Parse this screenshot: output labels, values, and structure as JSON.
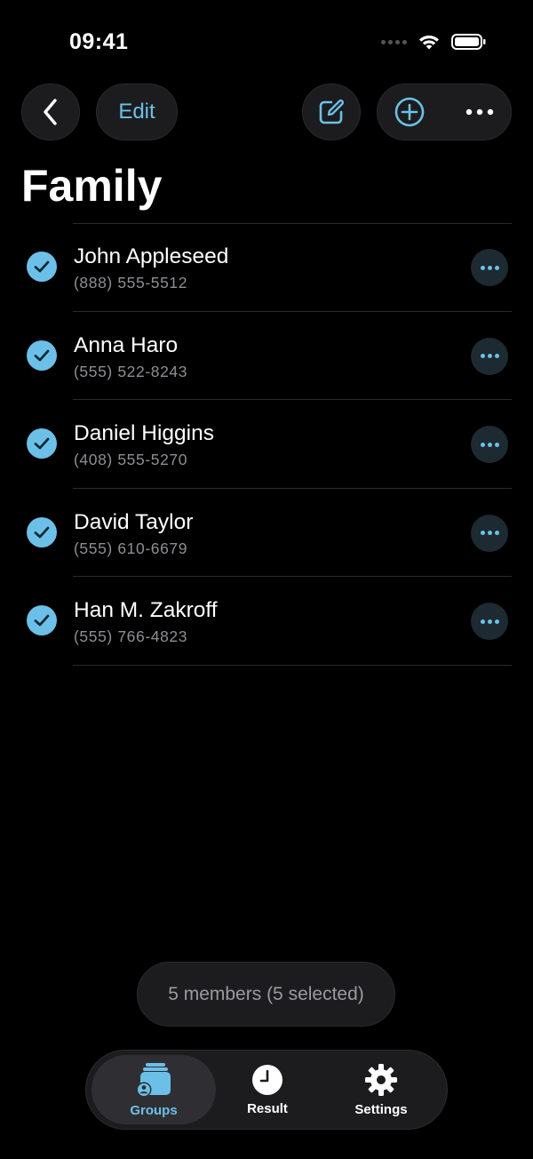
{
  "status_bar": {
    "time": "09:41"
  },
  "nav": {
    "edit_label": "Edit"
  },
  "page_title": "Family",
  "contacts": [
    {
      "name": "John Appleseed",
      "phone": "(888) 555-5512",
      "selected": true
    },
    {
      "name": "Anna Haro",
      "phone": "(555) 522-8243",
      "selected": true
    },
    {
      "name": "Daniel Higgins",
      "phone": "(408) 555-5270",
      "selected": true
    },
    {
      "name": "David Taylor",
      "phone": "(555) 610-6679",
      "selected": true
    },
    {
      "name": "Han M. Zakroff",
      "phone": "(555) 766-4823",
      "selected": true
    }
  ],
  "summary": "5 members (5 selected)",
  "tabs": [
    {
      "label": "Groups",
      "icon": "groups-icon",
      "active": true
    },
    {
      "label": "Result",
      "icon": "clock-icon",
      "active": false
    },
    {
      "label": "Settings",
      "icon": "gear-icon",
      "active": false
    }
  ],
  "colors": {
    "accent": "#6cc0e8",
    "background": "#000000",
    "surface": "#1c1c1e",
    "secondary_text": "#8e8e93"
  }
}
